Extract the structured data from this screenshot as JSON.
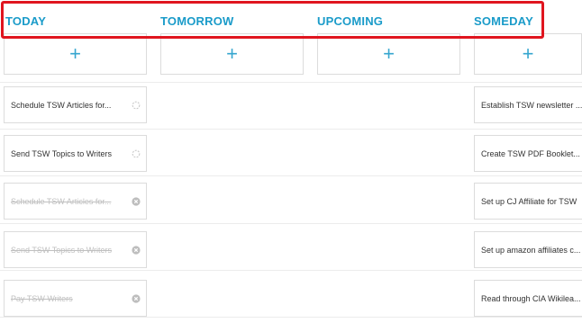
{
  "columns": [
    {
      "title": "TODAY"
    },
    {
      "title": "TOMORROW"
    },
    {
      "title": "UPCOMING"
    },
    {
      "title": "SOMEDAY"
    }
  ],
  "add_symbol": "+",
  "today_tasks": [
    {
      "label": "Schedule TSW Articles for...",
      "done": false
    },
    {
      "label": "Send TSW Topics to Writers",
      "done": false
    },
    {
      "label": "Schedule TSW Articles for...",
      "done": true
    },
    {
      "label": "Send TSW Topics to Writers",
      "done": true
    },
    {
      "label": "Pay TSW Writers",
      "done": true
    }
  ],
  "someday_tasks": [
    {
      "label": "Establish TSW newsletter ..."
    },
    {
      "label": "Create TSW PDF Booklet..."
    },
    {
      "label": "Set up CJ Affiliate for TSW"
    },
    {
      "label": "Set up amazon affiliates c..."
    },
    {
      "label": "Read through CIA Wikilea..."
    }
  ],
  "icons": {
    "pending": "spinner-icon",
    "done": "close-circle-icon"
  },
  "colors": {
    "accent": "#1a9bc9",
    "highlight": "#e0151f"
  }
}
